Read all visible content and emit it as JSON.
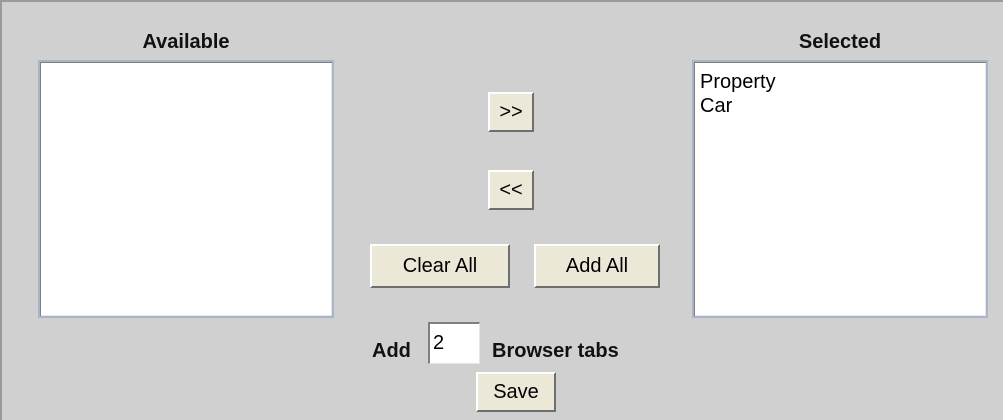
{
  "available": {
    "heading": "Available",
    "items": []
  },
  "selected": {
    "heading": "Selected",
    "items": [
      "Property",
      "Car"
    ]
  },
  "buttons": {
    "move_right": ">>",
    "move_left": "<<",
    "clear_all": "Clear All",
    "add_all": "Add All",
    "save": "Save"
  },
  "tabs_row": {
    "prefix": "Add",
    "value": "2",
    "suffix": "Browser tabs"
  }
}
